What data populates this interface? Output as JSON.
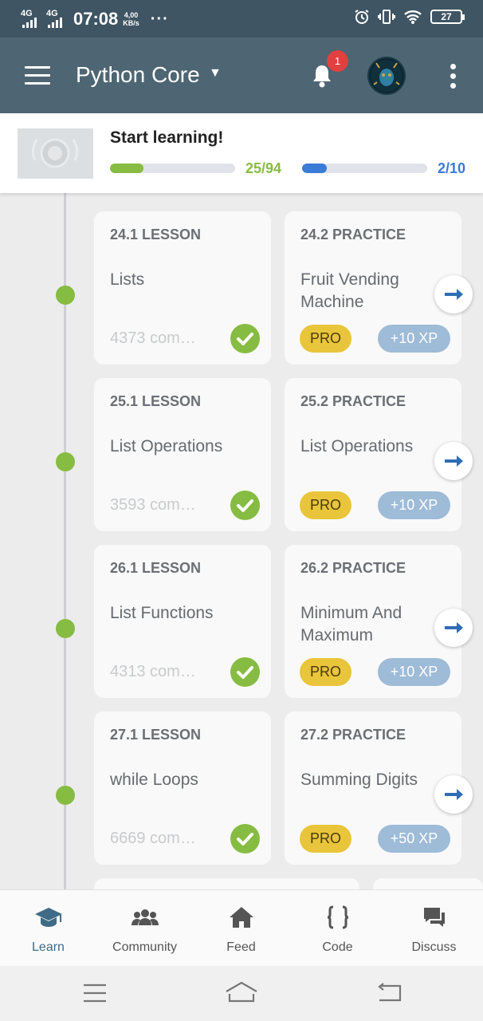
{
  "status_bar": {
    "signal_1": "4G",
    "signal_2": "4G",
    "time": "07:08",
    "speed_value": "4,00",
    "speed_unit": "KB/s",
    "more": "···",
    "battery": "27"
  },
  "app_bar": {
    "title": "Python Core",
    "notifications_count": "1"
  },
  "progress": {
    "title": "Start learning!",
    "lessons_text": "25/94",
    "lessons_fraction": 0.266,
    "practice_text": "2/10",
    "practice_fraction": 0.2,
    "lessons_color": "#86bc42",
    "practice_color": "#3a7bd5"
  },
  "modules": [
    {
      "lesson": {
        "header": "24.1 LESSON",
        "title": "Lists",
        "comments": "4373 com…",
        "completed": true
      },
      "practice": {
        "header": "24.2 PRACTICE",
        "title": "Fruit Vending Machine",
        "badge": "PRO",
        "xp": "+10 XP"
      }
    },
    {
      "lesson": {
        "header": "25.1 LESSON",
        "title": "List Operations",
        "comments": "3593 com…",
        "completed": true
      },
      "practice": {
        "header": "25.2 PRACTICE",
        "title": "List Operations",
        "badge": "PRO",
        "xp": "+10 XP"
      }
    },
    {
      "lesson": {
        "header": "26.1 LESSON",
        "title": "List Functions",
        "comments": "4313 com…",
        "completed": true
      },
      "practice": {
        "header": "26.2 PRACTICE",
        "title": "Minimum And Maximum",
        "badge": "PRO",
        "xp": "+10 XP"
      }
    },
    {
      "lesson": {
        "header": "27.1 LESSON",
        "title": "while Loops",
        "comments": "6669 com…",
        "completed": true
      },
      "practice": {
        "header": "27.2 PRACTICE",
        "title": "Summing Digits",
        "badge": "PRO",
        "xp": "+50 XP"
      }
    }
  ],
  "bottom_nav": {
    "items": [
      {
        "label": "Learn",
        "icon": "graduation-cap-icon",
        "active": true
      },
      {
        "label": "Community",
        "icon": "people-icon",
        "active": false
      },
      {
        "label": "Feed",
        "icon": "home-icon",
        "active": false
      },
      {
        "label": "Code",
        "icon": "braces-icon",
        "active": false
      },
      {
        "label": "Discuss",
        "icon": "chat-bubbles-icon",
        "active": false
      }
    ],
    "active_color": "#3f6b86"
  }
}
